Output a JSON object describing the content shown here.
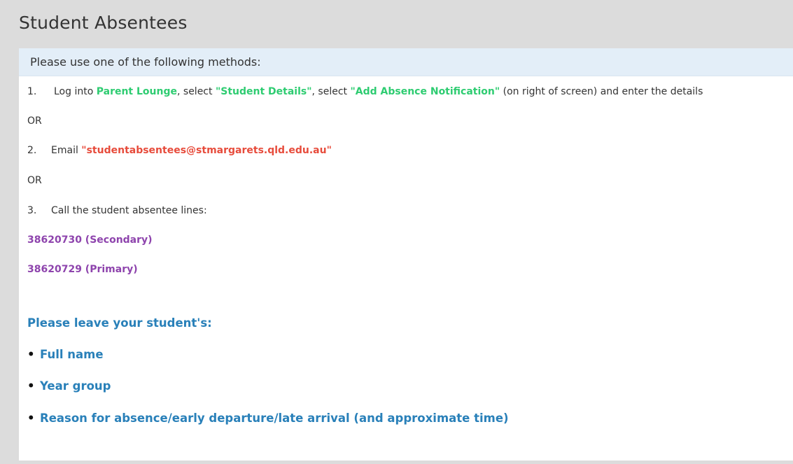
{
  "page": {
    "title": "Student Absentees"
  },
  "panel": {
    "header": "Please use one of the following methods:",
    "method1": {
      "number": "1.",
      "pre": "Log into ",
      "link1": "Parent Lounge",
      "mid1": ", select ",
      "link2": "\"Student Details\"",
      "mid2": ", select ",
      "link3": "\"Add Absence Notification\"",
      "post": " (on right of screen) and enter the details"
    },
    "or1": "OR",
    "method2": {
      "number": "2.",
      "pre": "Email ",
      "email": "\"studentabsentees@stmargarets.qld.edu.au\""
    },
    "or2": "OR",
    "method3": {
      "number": "3.",
      "text": "Call the student absentee lines:"
    },
    "phones": [
      "38620730 (Secondary)",
      "38620729 (Primary)"
    ],
    "leave_heading": "Please leave your student's:",
    "leave_items": [
      "Full name",
      "Year group",
      "Reason for absence/early departure/late arrival (and approximate time)"
    ]
  },
  "colors": {
    "background": "#dcdcdc",
    "header_band": "#e3eef8",
    "green": "#2ecc71",
    "red": "#e74c3c",
    "purple": "#8e44ad",
    "blue": "#2980b9"
  }
}
